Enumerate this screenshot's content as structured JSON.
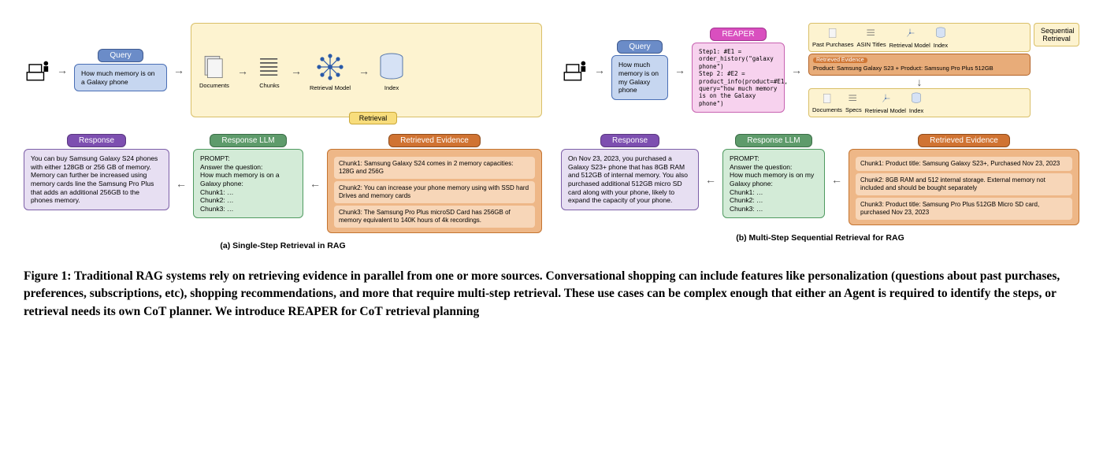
{
  "panelA": {
    "query_label": "Query",
    "query_text": "How much memory is on a Galaxy phone",
    "documents_label": "Documents",
    "chunks_label": "Chunks",
    "retrieval_model_label": "Retrieval Model",
    "index_label": "Index",
    "retrieval_label": "Retrieval",
    "response_label": "Response",
    "response_text": "You can buy Samsung Galaxy S24 phones with either 128GB or 256 GB of memory. Memory can further be increased using memory cards line the Samsung Pro Plus that adds an additional 256GB to the phones memory.",
    "llm_label": "Response LLM",
    "llm_text": "PROMPT:\nAnswer the question:\nHow much memory is on a Galaxy phone:\nChunk1: …\nChunk2: …\nChunk3: …",
    "evidence_label": "Retrieved Evidence",
    "chunk1": "Chunk1: Samsung Galaxy S24 comes in 2 memory capacities: 128G and 256G",
    "chunk2": "Chunk2: You can increase your phone memory using with SSD hard Drives and memory cards",
    "chunk3": "Chunk3: The Samsung Pro Plus microSD Card has 256GB of memory equivalent to 140K hours of 4k recordings.",
    "caption": "(a) Single-Step Retrieval in RAG"
  },
  "panelB": {
    "query_label": "Query",
    "query_text": "How much memory is on my Galaxy phone",
    "reaper_label": "REAPER",
    "reaper_text": "Step1: #E1 = order_history(\"galaxy phone\")\nStep 2: #E2 = product_info(product=#E1, query=\"how much memory is on the Galaxy phone\")",
    "seq_label": "Sequential Retrieval",
    "past_purchases": "Past Purchases",
    "asin_titles": "ASIN Titles",
    "retrieval_model_label": "Retrieval Model",
    "index_label": "Index",
    "first_ev_label": "Retrieved Evidence",
    "first_ev_text": "Product: Samsung Galaxy S23 + Product: Samsung Pro Plus 512GB",
    "documents_label": "Documents",
    "specs_label": "Specs",
    "response_label": "Response",
    "response_text": "On Nov 23, 2023, you purchased a Galaxy S23+ phone that has 8GB RAM and 512GB of internal memory. You also purchased additional 512GB micro SD card along with your phone, likely to expand the capacity of your phone.",
    "llm_label": "Response LLM",
    "llm_text": "PROMPT:\nAnswer the question:\nHow much memory is on my Galaxy phone:\nChunk1: …\nChunk2: …\nChunk3: …",
    "evidence_label": "Retrieved Evidence",
    "chunk1": "Chunk1: Product title: Samsung Galaxy S23+, Purchased Nov 23, 2023",
    "chunk2": "Chunk2: 8GB RAM and 512 internal storage. External memory not included and should be bought separately",
    "chunk3": "Chunk3: Product title: Samsung Pro Plus 512GB Micro SD card, purchased Nov 23, 2023",
    "caption": "(b) Multi-Step Sequential Retrieval for RAG"
  },
  "figure_caption": "Figure 1: Traditional RAG systems rely on retrieving evidence in parallel from one or more sources. Conversational shopping can include features like personalization (questions about past purchases, preferences, subscriptions, etc), shopping recommendations, and more that require multi-step retrieval. These use cases can be complex enough that either an Agent is required to identify the steps, or retrieval needs its own CoT planner. We introduce REAPER for CoT retrieval planning"
}
